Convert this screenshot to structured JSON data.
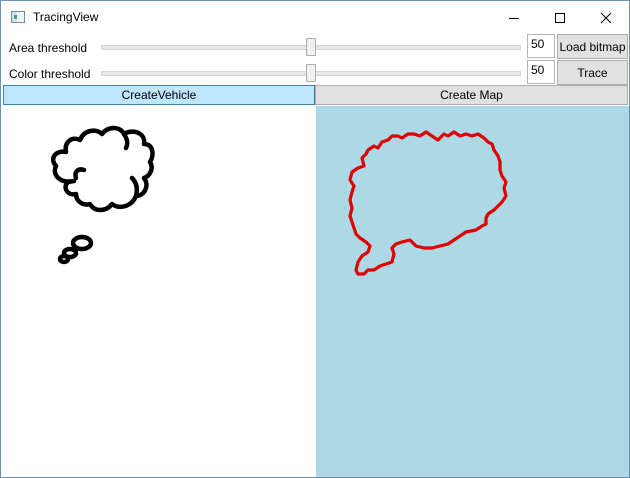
{
  "window": {
    "title": "TracingView",
    "icon": "app-window-icon",
    "controls": [
      "minimize-icon",
      "maximize-icon",
      "close-icon"
    ]
  },
  "area_row": {
    "label": "Area threshold",
    "value": "50",
    "slider_fraction": 0.5
  },
  "color_row": {
    "label": "Color threshold",
    "value": "50",
    "slider_fraction": 0.5
  },
  "buttons": {
    "load": "Load bitmap",
    "trace": "Trace"
  },
  "tabs": [
    {
      "label": "CreateVehicle",
      "active": true
    },
    {
      "label": "Create Map",
      "active": false
    }
  ],
  "canvas": {
    "left_background": "#ffffff",
    "right_background": "#add8e6",
    "source_stroke": "#000000",
    "traced_stroke": "#e00000"
  }
}
